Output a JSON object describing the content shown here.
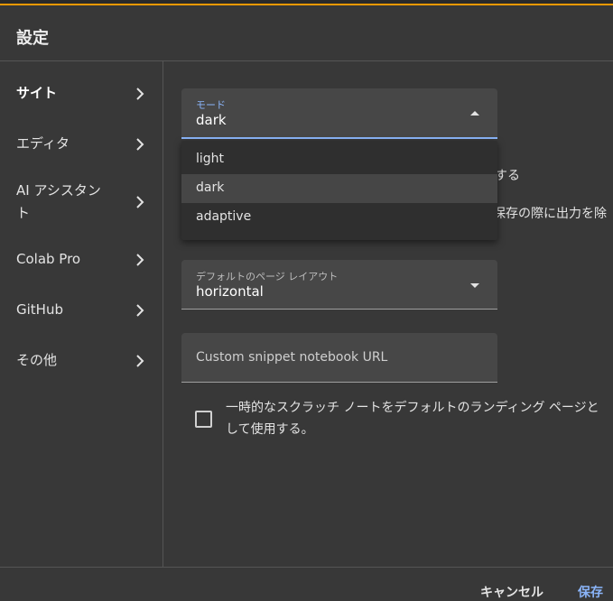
{
  "dialog": {
    "title": "設定"
  },
  "sidebar": {
    "items": [
      {
        "label": "サイト"
      },
      {
        "label": "エディタ"
      },
      {
        "label": "AI アシスタント"
      },
      {
        "label": "Colab Pro"
      },
      {
        "label": "GitHub"
      },
      {
        "label": "その他"
      }
    ]
  },
  "mode": {
    "label": "モード",
    "value": "dark",
    "options": [
      "light",
      "dark",
      "adaptive"
    ]
  },
  "partial_text": {
    "line1": "する",
    "line2": "保存の際に出力を除"
  },
  "layout": {
    "label": "デフォルトのページ レイアウト",
    "value": "horizontal"
  },
  "snippet": {
    "placeholder": "Custom snippet notebook URL"
  },
  "scratch": {
    "label": "一時的なスクラッチ ノートをデフォルトのランディング ページとして使用する。",
    "checked": false
  },
  "footer": {
    "cancel_label": "キャンセル",
    "save_label": "保存"
  },
  "colors": {
    "accent": "#8ab4f8",
    "background": "#383838",
    "top_strip_accent": "#f29900"
  }
}
